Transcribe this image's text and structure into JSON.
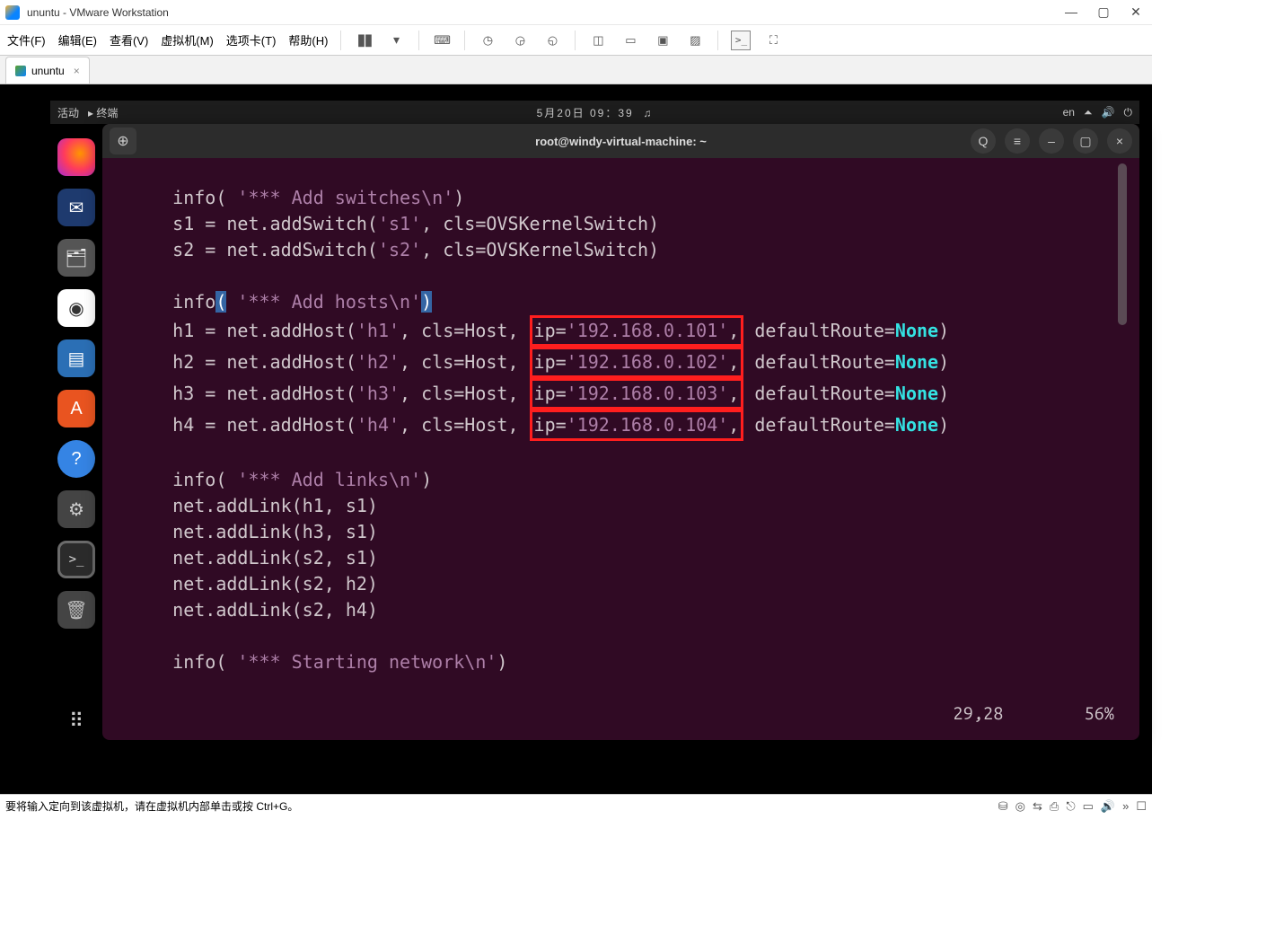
{
  "window": {
    "title": "ununtu - VMware Workstation"
  },
  "menu": {
    "file": "文件(F)",
    "edit": "编辑(E)",
    "view": "查看(V)",
    "vm": "虚拟机(M)",
    "tabs": "选项卡(T)",
    "help": "帮助(H)"
  },
  "tab": {
    "name": "ununtu"
  },
  "ubuntu": {
    "activities": "活动",
    "termLabel": "终端",
    "clock": "5月20日  09：39",
    "lang": "en"
  },
  "terminal": {
    "title": "root@windy-virtual-machine: ~",
    "cursorPos": "29,28",
    "scrollPct": "56%",
    "code": {
      "l1": "    info( ",
      "l1s": "'*** Add switches\\n'",
      "l1e": ")",
      "l2": "    s1 = net.addSwitch(",
      "l2s": "'s1'",
      "l2e": ", cls=OVSKernelSwitch)",
      "l3": "    s2 = net.addSwitch(",
      "l3s": "'s2'",
      "l3e": ", cls=OVSKernelSwitch)",
      "l5": "    info",
      "l5h1": "(",
      "l5m": " ",
      "l5s": "'*** Add hosts\\n'",
      "l5h2": ")",
      "h1a": "    h1 = net.addHost(",
      "h1s": "'h1'",
      "h1b": ", cls=Host, ",
      "h1ip": "ip=",
      "h1ips": "'192.168.0.101'",
      "h1c": ",",
      "h1d": " defaultRoute=",
      "h1e": ")",
      "h2a": "    h2 = net.addHost(",
      "h2s": "'h2'",
      "h2b": ", cls=Host, ",
      "h2ip": "ip=",
      "h2ips": "'192.168.0.102'",
      "h2c": ",",
      "h2d": " defaultRoute=",
      "h2e": ")",
      "h3a": "    h3 = net.addHost(",
      "h3s": "'h3'",
      "h3b": ", cls=Host, ",
      "h3ip": "ip=",
      "h3ips": "'192.168.0.103'",
      "h3c": ",",
      "h3d": " defaultRoute=",
      "h3e": ")",
      "h4a": "    h4 = net.addHost(",
      "h4s": "'h4'",
      "h4b": ", cls=Host, ",
      "h4ip": "ip=",
      "h4ips": "'192.168.0.104'",
      "h4c": ",",
      "h4d": " defaultRoute=",
      "h4e": ")",
      "none": "None",
      "ll1": "    info( ",
      "ll1s": "'*** Add links\\n'",
      "ll1e": ")",
      "al1": "    net.addLink(h1, s1)",
      "al2": "    net.addLink(h3, s1)",
      "al3": "    net.addLink(s2, s1)",
      "al4": "    net.addLink(s2, h2)",
      "al5": "    net.addLink(s2, h4)",
      "sn1": "    info( ",
      "sn1s": "'*** Starting network\\n'",
      "sn1e": ")"
    }
  },
  "status": {
    "hint": "要将输入定向到该虚拟机，请在虚拟机内部单击或按 Ctrl+G。"
  }
}
